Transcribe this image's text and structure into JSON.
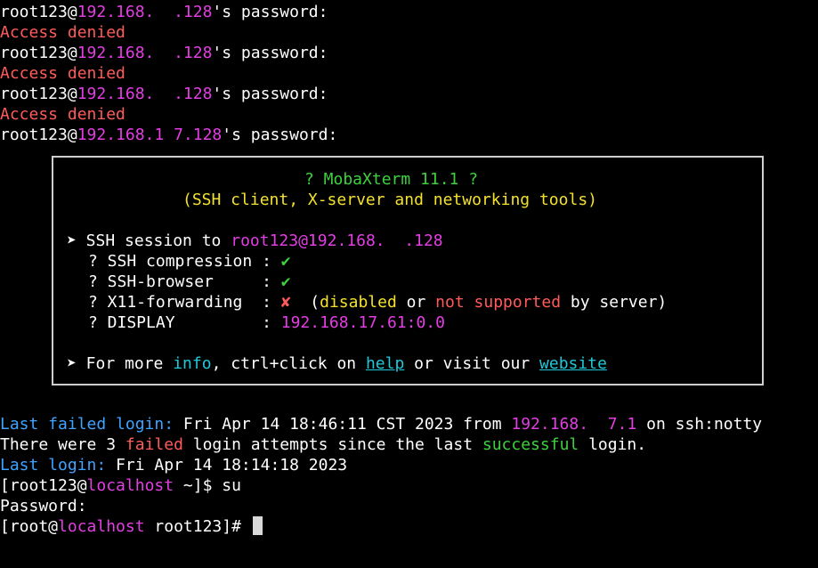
{
  "colors": {
    "background": "#000000",
    "error": "#ff5b5b",
    "host": "#e33ee3",
    "label": "#3fa3ff",
    "success": "#3ed13e",
    "title": "#f3e12e",
    "link": "#20c8d8"
  },
  "attempts": [
    {
      "user": "root123@",
      "ip": "192.168.  .128",
      "suffix": "'s password:",
      "denied": "Access denied"
    },
    {
      "user": "root123@",
      "ip": "192.168.  .128",
      "suffix": "'s password:",
      "denied": "Access denied"
    },
    {
      "user": "root123@",
      "ip": "192.168.  .128",
      "suffix": "'s password:",
      "denied": "Access denied"
    },
    {
      "user": "root123@",
      "ip": "192.168.1 7.128",
      "suffix": "'s password:"
    }
  ],
  "banner": {
    "title": "? MobaXterm 11.1 ?",
    "subtitle": "(SSH client, X-server and networking tools)",
    "session_prefix": "➤ SSH session to ",
    "session_user": "root123",
    "session_host": "@192.168.  .128",
    "compression_label": "? SSH compression : ",
    "compression_value": "✔",
    "browser_label": "? SSH-browser     : ",
    "browser_value": "✔",
    "x11_label": "? X11-forwarding  : ",
    "x11_value": "✘",
    "x11_note_open": "  (",
    "x11_disabled": "disabled",
    "x11_or": " or ",
    "x11_not_supported": "not supported",
    "x11_note_close": " by server)",
    "display_label": "? DISPLAY         : ",
    "display_value": "192.168.17.61:0.0",
    "more_prefix": "➤ For more ",
    "more_info": "info",
    "more_mid": ", ctrl+click on ",
    "more_help": "help",
    "more_mid2": " or visit our ",
    "more_website": "website"
  },
  "login": {
    "failed_label": "Last failed login:",
    "failed_text": " Fri Apr 14 18:46:11 CST 2023 from ",
    "failed_ip": "192.168.  7.1",
    "failed_tail": " on ssh:notty",
    "there_were": "There were 3 ",
    "failed_word": "failed",
    "attempts_mid": " login attempts since the last ",
    "successful_word": "successful",
    "attempts_end": " login.",
    "last_label": "Last login:",
    "last_text": " Fri Apr 14 18:14:18 2023"
  },
  "shell": {
    "prompt1_open": "[root123@",
    "prompt1_host": "localhost",
    "prompt1_close": " ~]$ ",
    "cmd1": "su",
    "password_prompt": "Password:",
    "prompt2_open": "[root@",
    "prompt2_host": "localhost",
    "prompt2_close": " root123]# "
  }
}
